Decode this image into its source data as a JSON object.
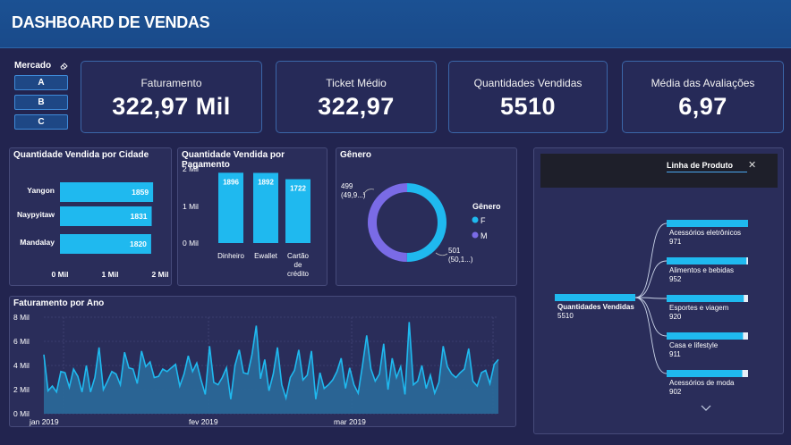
{
  "header": {
    "title": "DASHBOARD DE VENDAS"
  },
  "slicer": {
    "title": "Mercado",
    "options": [
      "A",
      "B",
      "C"
    ]
  },
  "kpis": [
    {
      "label": "Faturamento",
      "value": "322,97 Mil"
    },
    {
      "label": "Ticket Médio",
      "value": "322,97"
    },
    {
      "label": "Quantidades Vendidas",
      "value": "5510"
    },
    {
      "label": "Média das Avaliações",
      "value": "6,97"
    }
  ],
  "colors": {
    "accent": "#1fb9ef",
    "female": "#1fb9ef",
    "male": "#7a6be6",
    "area_fill": "#2a6a9a"
  },
  "chart_data": [
    {
      "type": "bar",
      "orientation": "horizontal",
      "title": "Quantidade Vendida por Cidade",
      "categories": [
        "Yangon",
        "Naypyitaw",
        "Mandalay"
      ],
      "values": [
        1859,
        1831,
        1820
      ],
      "value_labels": [
        "1859",
        "1831",
        "1820"
      ],
      "xticks": [
        "0 Mil",
        "1 Mil",
        "2 Mil"
      ],
      "xlim": [
        0,
        2000
      ]
    },
    {
      "type": "bar",
      "title": "Quantidade Vendida por Pagamento",
      "categories": [
        "Dinheiro",
        "Ewallet",
        "Cartão de crédito"
      ],
      "category_lines": [
        [
          "Dinheiro"
        ],
        [
          "Ewallet"
        ],
        [
          "Cartão",
          "de",
          "crédito"
        ]
      ],
      "values": [
        1896,
        1892,
        1722
      ],
      "value_labels": [
        "1896",
        "1892",
        "1722"
      ],
      "yticks": [
        "2 Mil",
        "1 Mil",
        "0 Mil"
      ],
      "ylim": [
        0,
        2000
      ]
    },
    {
      "type": "pie",
      "title": "Gênero",
      "legend_title": "Gênero",
      "labels": [
        "F",
        "M"
      ],
      "values": [
        501,
        499
      ],
      "annotations": [
        {
          "lines": [
            "501",
            "(50,1...)"
          ]
        },
        {
          "lines": [
            "499",
            "(49,9...)"
          ]
        }
      ]
    },
    {
      "type": "area",
      "title": "Faturamento por Ano",
      "xticks": [
        "jan 2019",
        "fev 2019",
        "mar 2019"
      ],
      "yticks": [
        "8 Mil",
        "6 Mil",
        "4 Mil",
        "2 Mil",
        "0 Mil"
      ],
      "ylim": [
        0,
        8000
      ],
      "values": [
        4900,
        1900,
        2300,
        1800,
        3500,
        3400,
        2200,
        3700,
        3100,
        1800,
        4000,
        1800,
        3000,
        5500,
        2000,
        2700,
        3500,
        3300,
        2400,
        5100,
        3800,
        3700,
        2500,
        5200,
        3900,
        4300,
        3000,
        3100,
        3700,
        3500,
        3800,
        4100,
        2300,
        3300,
        4800,
        3500,
        4200,
        2800,
        1600,
        5600,
        2600,
        2400,
        3000,
        3800,
        1200,
        4000,
        5300,
        3400,
        3300,
        4900,
        7300,
        2900,
        4500,
        1900,
        3300,
        5500,
        2400,
        1300,
        3000,
        3600,
        5300,
        2800,
        3200,
        5200,
        1200,
        3400,
        2100,
        2400,
        2800,
        3500,
        4600,
        2100,
        3800,
        2400,
        1700,
        4000,
        6500,
        3700,
        2700,
        3300,
        5800,
        2000,
        4600,
        3000,
        3900,
        1600,
        7600,
        2400,
        2700,
        4000,
        2100,
        3200,
        1700,
        2600,
        5600,
        3900,
        3300,
        3000,
        3400,
        3700,
        5400,
        2700,
        2300,
        3400,
        3600,
        2500,
        4100,
        4500
      ]
    },
    {
      "type": "decomposition_tree",
      "header_label": "Linha de Produto",
      "root": {
        "label": "Quantidades Vendidas",
        "value": "5510",
        "amount": 5510
      },
      "nodes": [
        {
          "label": "Acessórios eletrônicos",
          "value": "971",
          "amount": 971
        },
        {
          "label": "Alimentos e bebidas",
          "value": "952",
          "amount": 952
        },
        {
          "label": "Esportes e viagem",
          "value": "920",
          "amount": 920
        },
        {
          "label": "Casa e lifestyle",
          "value": "911",
          "amount": 911
        },
        {
          "label": "Acessórios de moda",
          "value": "902",
          "amount": 902
        }
      ]
    }
  ]
}
